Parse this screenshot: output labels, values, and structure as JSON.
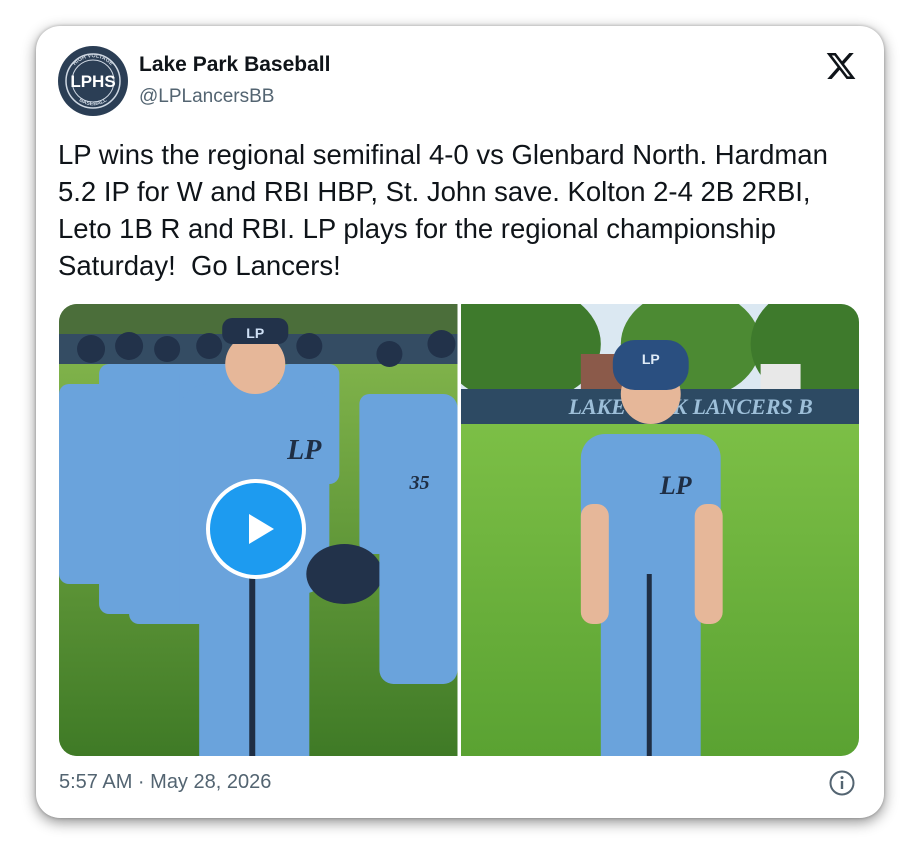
{
  "author": {
    "name": "Lake Park Baseball",
    "handle": "@LPLancersBB",
    "avatar": {
      "logo_text": "LPHS",
      "ring_top": "HIGH VOLTAGE",
      "ring_bottom": "BASEBALL"
    }
  },
  "brand_icon": "x-logo-icon",
  "tweet": {
    "text": "LP wins the regional semifinal 4-0 vs Glenbard North. Hardman 5.2 IP for W and RBI HBP, St. John save. Kolton 2-4 2B 2RBI, Leto 1B R and RBI. LP plays for the regional championship Saturday!  Go Lancers!"
  },
  "media": {
    "video": {
      "has_play_button": true,
      "cap_logo": "LP",
      "jersey_logo": "LP",
      "number": "35"
    },
    "photo": {
      "banner_text": "LAKE PARK LANCERS B",
      "cap_logo": "LP",
      "jersey_logo": "LP"
    }
  },
  "footer": {
    "timestamp": "5:57 AM · May 28, 2026",
    "info_icon": "info-icon"
  },
  "colors": {
    "accent": "#1d9bf0",
    "text": "#0f1419",
    "secondary_text": "#536471",
    "uniform": "#6aa3dc"
  }
}
